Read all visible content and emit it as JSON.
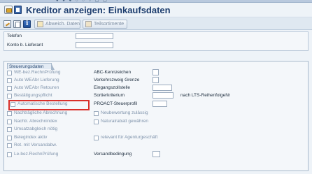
{
  "window": {
    "title": "Kreditor anzeigen: Einkaufsdaten"
  },
  "toolbar": {
    "buttons": [
      {
        "label": "Abweich. Daten",
        "icon": "document-icon"
      },
      {
        "label": "Teilsortimente",
        "icon": "list-icon"
      }
    ]
  },
  "header_fields": {
    "telefon_label": "Telefon",
    "konto_label": "Konto b. Lieferant",
    "telefon_value": "",
    "konto_value": ""
  },
  "steuerungsdaten": {
    "title": "Steuerungsdaten",
    "checkboxes": [
      {
        "label": "WE-bez.RechnPrüfung",
        "checked": false
      },
      {
        "label": "Auto WEAbr Lieferung",
        "checked": false
      },
      {
        "label": "Auto WEAbr Retouren",
        "checked": false
      },
      {
        "label": "Bestätigungspflicht",
        "checked": false
      },
      {
        "label": "Automatische Bestellung",
        "checked": false
      },
      {
        "label": "Nachträgliche Abrechnung",
        "checked": false
      },
      {
        "label": "Nachtr. Abrechnindex",
        "checked": false
      },
      {
        "label": "Umsatzabgleich nötig",
        "checked": false
      },
      {
        "label": "Belegindex aktiv",
        "checked": false
      },
      {
        "label": "Ret. mit Versandabw.",
        "checked": false
      },
      {
        "label": "Le-bez.RechnPrüfung",
        "checked": false
      }
    ],
    "right_fields": [
      {
        "label": "ABC-Kennzeichen",
        "value": ""
      },
      {
        "label": "Verkehrszweig Grenze",
        "value": ""
      },
      {
        "label": "Eingangszollstelle",
        "value": ""
      },
      {
        "label": "Sortierkriterium",
        "value": "nach LTS-ReihenfolgeNr"
      },
      {
        "label": "PROACT-Steuerprofil",
        "value": ""
      }
    ],
    "right_checkboxes": [
      {
        "label": "Neubewertung zulässig",
        "checked": false
      },
      {
        "label": "Naturalrabatt gewähren",
        "checked": false
      },
      {
        "label": "relevant für Agenturgeschäft",
        "checked": false
      }
    ],
    "versand": {
      "label": "Versandbedingung",
      "value": ""
    }
  },
  "highlight": {
    "target": "Automatische Bestellung",
    "color": "#d9302b"
  }
}
